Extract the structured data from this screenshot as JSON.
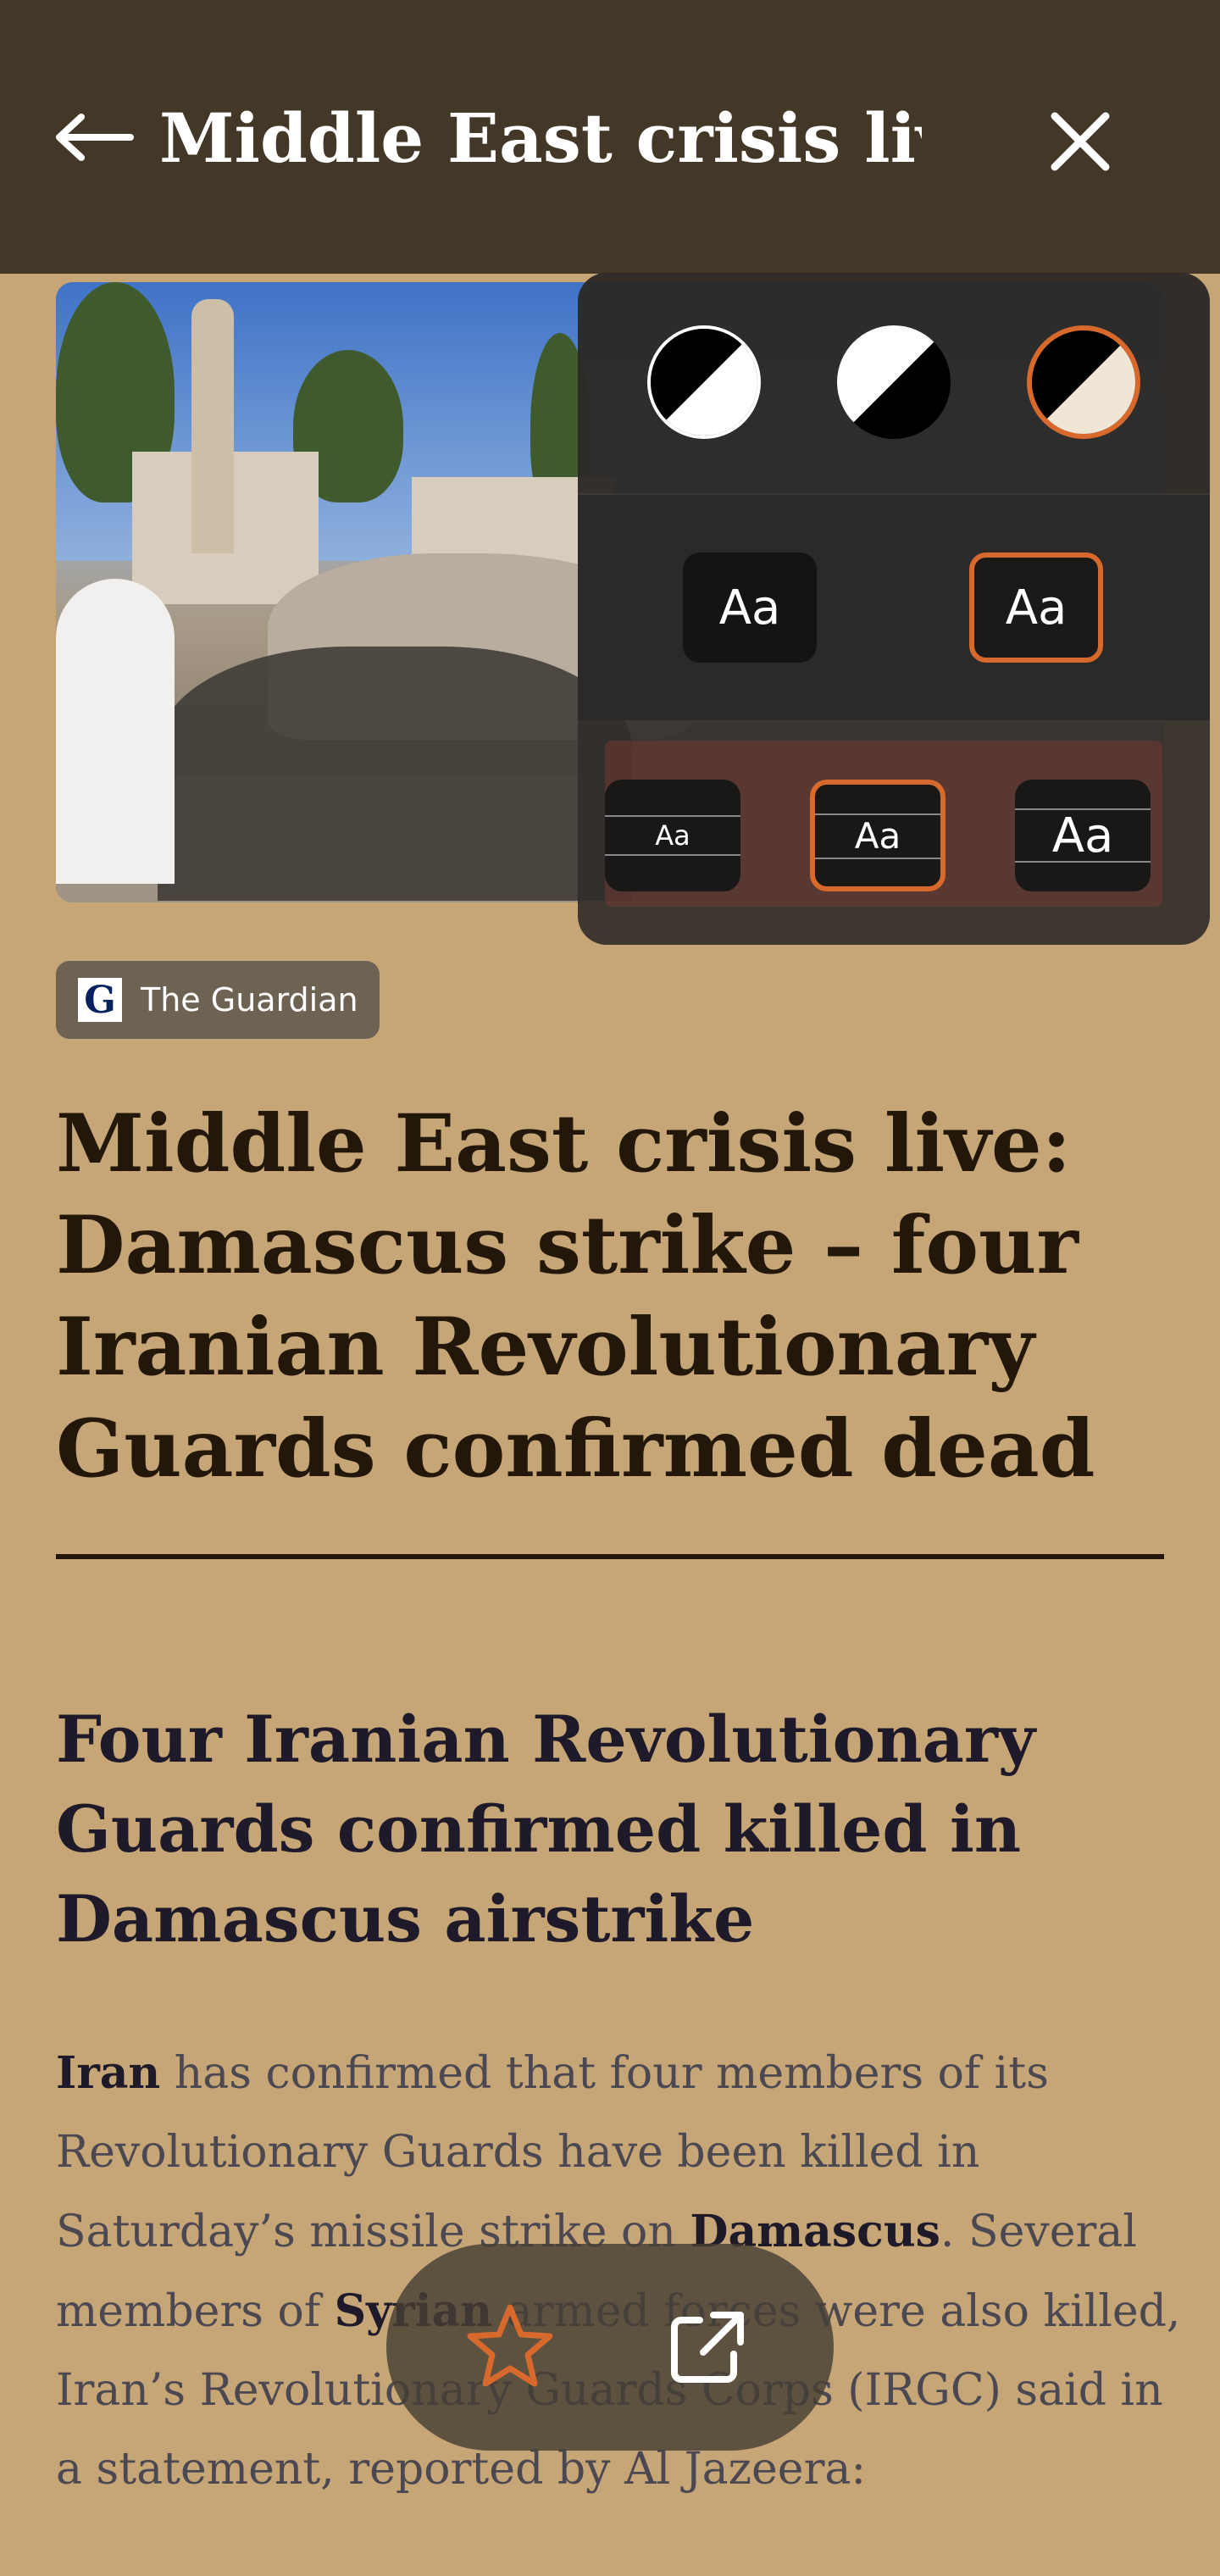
{
  "topbar": {
    "title": "Middle East crisis liv...",
    "back_icon": "arrow-left-icon",
    "close_icon": "close-icon"
  },
  "settings": {
    "themes": [
      {
        "name": "dark",
        "selected": false
      },
      {
        "name": "light",
        "selected": false
      },
      {
        "name": "sepia",
        "selected": true
      }
    ],
    "fonts": [
      {
        "label": "Aa",
        "style": "sans",
        "selected": false
      },
      {
        "label": "Aa",
        "style": "sans",
        "selected": true
      }
    ],
    "sizes": [
      {
        "label": "Aa",
        "selected": false
      },
      {
        "label": "Aa",
        "selected": true
      },
      {
        "label": "Aa",
        "selected": false
      }
    ]
  },
  "source": {
    "logo_letter": "G",
    "name": "The Guardian"
  },
  "article": {
    "headline": "Middle East crisis live: Damascus strike – four Iranian Revolutionary Guards confirmed dead",
    "subheading": "Four Iranian Revolutionary Guards confirmed killed in Damascus airstrike",
    "body": {
      "p1_iran": "Iran",
      "p1_a": " has confirmed that four members of its Revolutionary Guards have been killed in Saturday’s missile strike on ",
      "p1_damascus": "Damascus",
      "p1_b": ". Several members of ",
      "p1_syrian": "Syrian",
      "p1_c": " armed forces were also killed, Iran’s Revolutionary Guards Corps (IRGC) said in a statement, reported by Al Jazeera:"
    }
  },
  "actions": {
    "favorite_icon": "star-outline-icon",
    "open_external_icon": "open-external-icon"
  },
  "colors": {
    "background": "#c6a677",
    "topbar": "#433828",
    "accent": "#d6692b"
  }
}
